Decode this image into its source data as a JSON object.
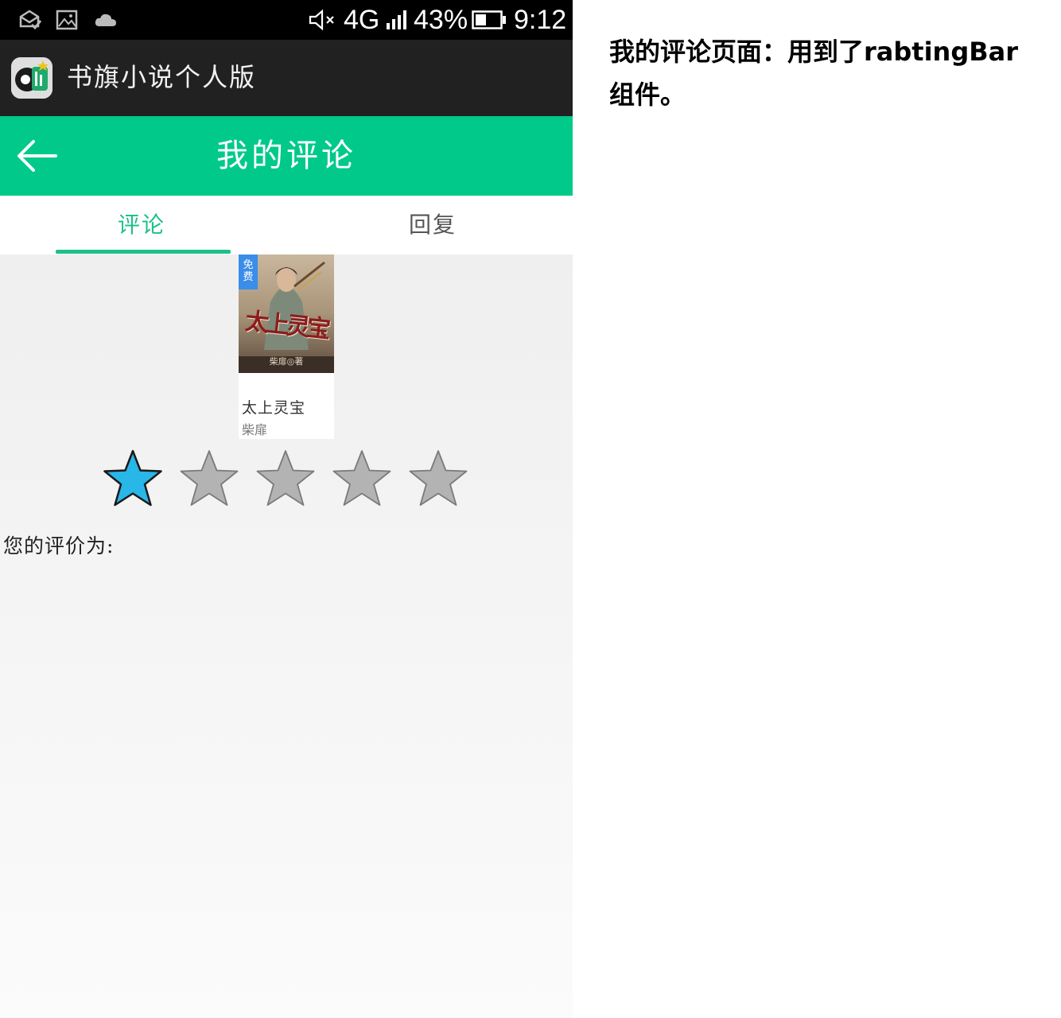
{
  "status_bar": {
    "network": "4G",
    "battery": "43%",
    "time": "9:12",
    "icons": [
      "mail-check-icon",
      "image-icon",
      "cloud-icon",
      "mute-icon",
      "signal-icon",
      "battery-icon"
    ]
  },
  "app_bar": {
    "title": "书旗小说个人版",
    "icon": "app-logo-icon"
  },
  "header": {
    "title": "我的评论",
    "back_icon": "back-arrow-icon",
    "color": "#00c989"
  },
  "tabs": [
    {
      "label": "评论",
      "active": true
    },
    {
      "label": "回复",
      "active": false
    }
  ],
  "book": {
    "badge": "免费",
    "cover_title": "太上灵宝",
    "cover_author": "柴扉◎著",
    "name": "太上灵宝",
    "author": "柴扉"
  },
  "rating": {
    "value": 1,
    "max": 5,
    "active_color": "#29b6e8",
    "inactive_color": "#b3b3b3"
  },
  "rating_label": "您的评价为:",
  "caption": "我的评论页面：用到了rabtingBar组件。",
  "accent_color": "#1ec08a"
}
